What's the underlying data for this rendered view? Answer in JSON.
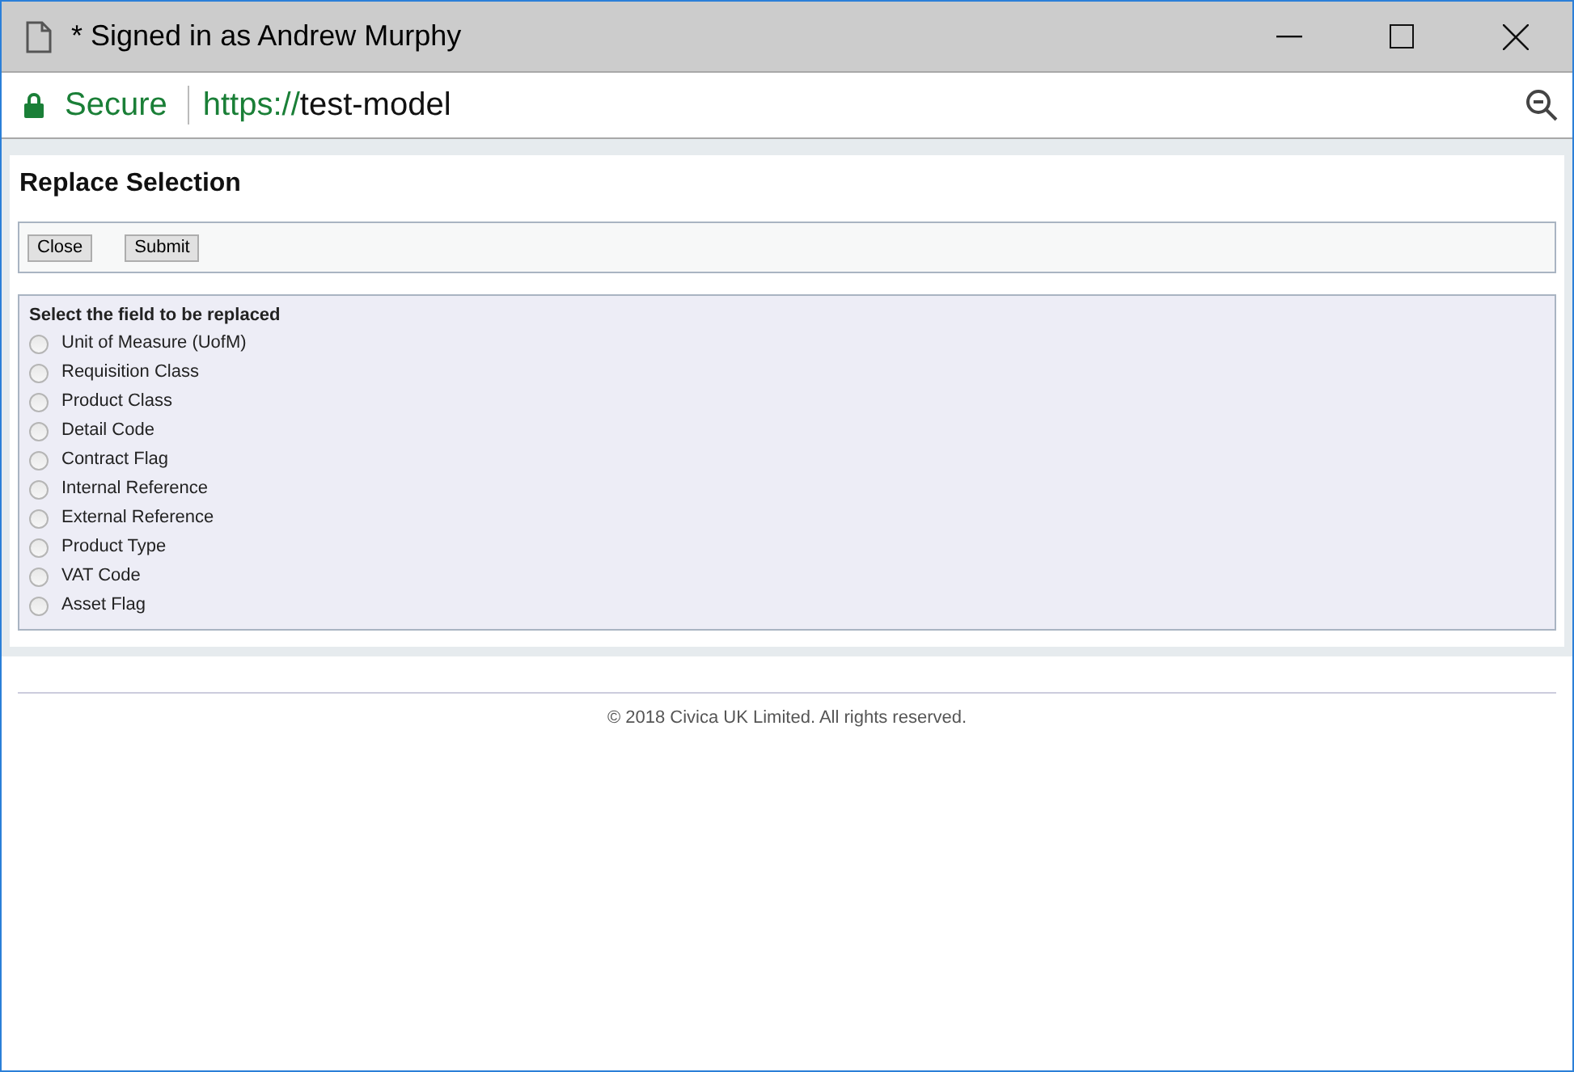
{
  "window": {
    "title": "* Signed in as Andrew Murphy"
  },
  "address_bar": {
    "security": "Secure",
    "scheme": "https://",
    "host": "test-model"
  },
  "page": {
    "heading": "Replace Selection",
    "buttons": [
      "Close",
      "Submit"
    ],
    "group_label": "Select the field to be replaced",
    "options": [
      {
        "label": "Unit of Measure (UofM)",
        "selected": false
      },
      {
        "label": "Requisition Class",
        "selected": false
      },
      {
        "label": "Product Class",
        "selected": false
      },
      {
        "label": "Detail Code",
        "selected": false
      },
      {
        "label": "Contract Flag",
        "selected": false
      },
      {
        "label": "Internal Reference",
        "selected": false
      },
      {
        "label": "External Reference",
        "selected": false
      },
      {
        "label": "Product Type",
        "selected": false
      },
      {
        "label": "VAT Code",
        "selected": false
      },
      {
        "label": "Asset Flag",
        "selected": false
      }
    ]
  },
  "footer": "© 2018 Civica UK Limited. All rights reserved."
}
